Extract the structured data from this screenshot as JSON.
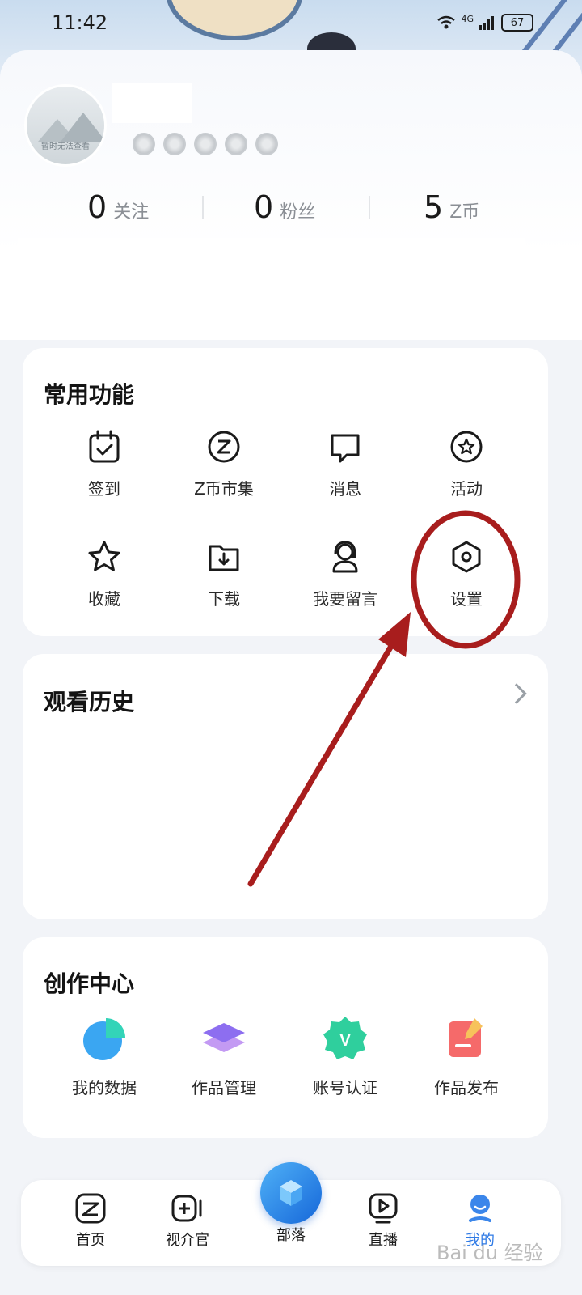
{
  "status_bar": {
    "time": "11:42",
    "network": "4G",
    "battery": "67"
  },
  "profile": {
    "avatar_text": "暂时无法查看",
    "stats": [
      {
        "value": "0",
        "label": "关注"
      },
      {
        "value": "0",
        "label": "粉丝"
      },
      {
        "value": "5",
        "label": "Z币"
      }
    ]
  },
  "common_functions": {
    "title": "常用功能",
    "items": [
      {
        "label": "签到",
        "icon": "calendar-check-icon"
      },
      {
        "label": "Z币市集",
        "icon": "z-coin-icon"
      },
      {
        "label": "消息",
        "icon": "message-icon"
      },
      {
        "label": "活动",
        "icon": "star-badge-icon"
      },
      {
        "label": "收藏",
        "icon": "star-icon"
      },
      {
        "label": "下载",
        "icon": "download-folder-icon"
      },
      {
        "label": "我要留言",
        "icon": "headset-icon"
      },
      {
        "label": "设置",
        "icon": "settings-hexagon-icon"
      }
    ]
  },
  "watch_history": {
    "title": "观看历史"
  },
  "creator_center": {
    "title": "创作中心",
    "items": [
      {
        "label": "我的数据",
        "icon": "pie-chart-icon"
      },
      {
        "label": "作品管理",
        "icon": "layers-icon"
      },
      {
        "label": "账号认证",
        "icon": "verified-v-icon"
      },
      {
        "label": "作品发布",
        "icon": "publish-note-icon"
      }
    ]
  },
  "bottom_nav": {
    "items": [
      {
        "label": "首页",
        "icon": "home-z-icon"
      },
      {
        "label": "视介官",
        "icon": "video-add-icon"
      },
      {
        "label": "部落",
        "icon": "cube-icon"
      },
      {
        "label": "直播",
        "icon": "live-play-icon"
      },
      {
        "label": "我的",
        "icon": "profile-icon"
      }
    ],
    "active": "我的"
  },
  "colors": {
    "accent": "#2f7ae5",
    "annotation": "#a81d1d"
  },
  "watermark": "Bai du 经验"
}
